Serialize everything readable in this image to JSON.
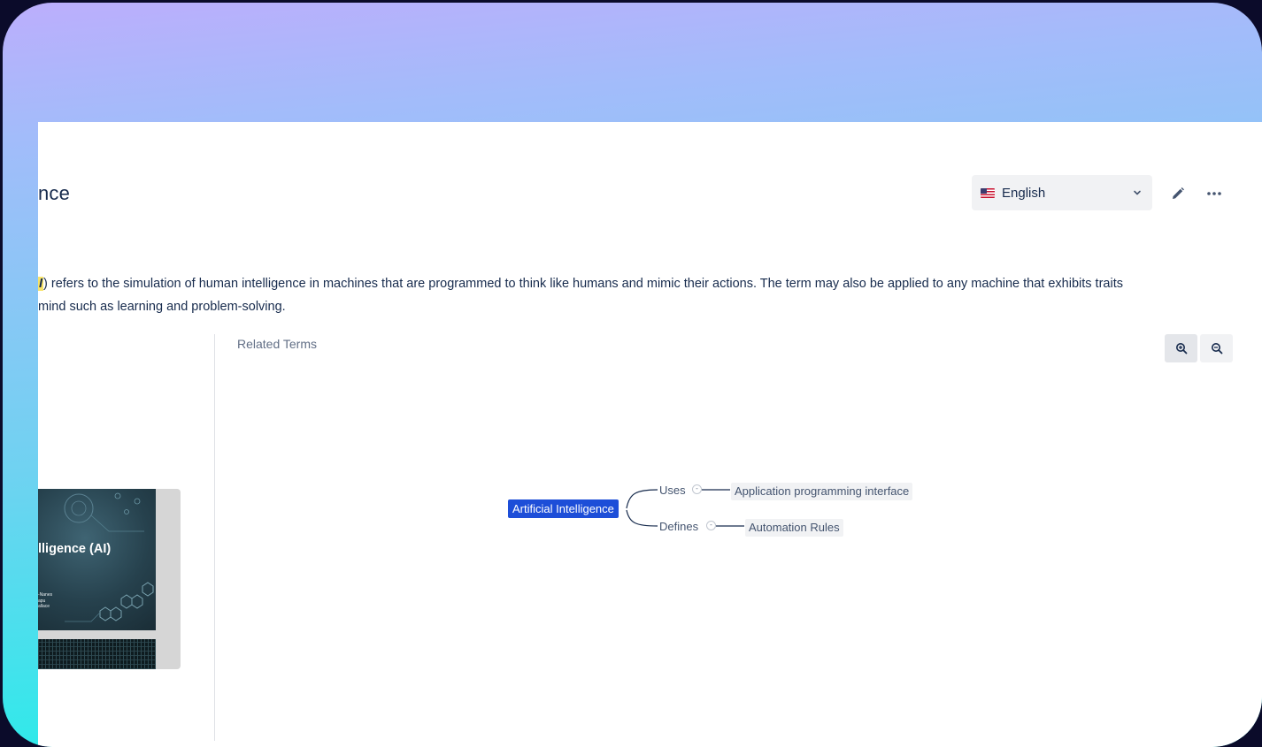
{
  "page": {
    "title_visible": "nce"
  },
  "language": {
    "selected": "English",
    "flag_icon": "us-flag-icon"
  },
  "toolbar": {
    "edit_icon": "pencil-icon",
    "more_icon": "more-horizontal-icon"
  },
  "description": {
    "highlight": "I",
    "line1": ") refers to the simulation of human intelligence in machines that are programmed to think like humans and mimic their actions. The term may also be applied to any machine that exhibits traits",
    "line2": " mind such as learning and problem-solving."
  },
  "preview": {
    "slide_title": "lligence (AI)",
    "slide_meta": [
      "-Nanes",
      "apu",
      "allace"
    ]
  },
  "related": {
    "label": "Related Terms",
    "zoom_in_icon": "zoom-in-icon",
    "zoom_out_icon": "zoom-out-icon"
  },
  "mindmap": {
    "root": "Artificial Intelligence",
    "branches": [
      {
        "relation": "Uses",
        "toggle": "-",
        "target": "Application programming interface"
      },
      {
        "relation": "Defines",
        "toggle": "-",
        "target": "Automation Rules"
      }
    ]
  },
  "colors": {
    "accent": "#1d4ed8",
    "highlight": "#f7e36a",
    "text": "#172b4d",
    "muted": "#626f86"
  }
}
